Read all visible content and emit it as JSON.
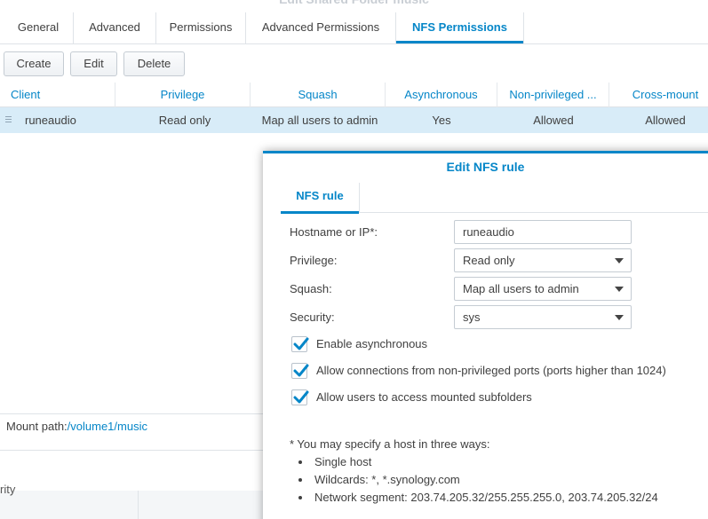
{
  "window": {
    "title": "Edit Shared Folder music"
  },
  "tabs": [
    "General",
    "Advanced",
    "Permissions",
    "Advanced Permissions",
    "NFS Permissions"
  ],
  "toolbar": {
    "create": "Create",
    "edit": "Edit",
    "delete": "Delete"
  },
  "grid": {
    "columns": [
      "Client",
      "Privilege",
      "Squash",
      "Asynchronous",
      "Non-privileged ...",
      "Cross-mount"
    ],
    "rows": [
      {
        "client": "runeaudio",
        "privilege": "Read only",
        "squash": "Map all users to admin",
        "asynchronous": "Yes",
        "non_privileged": "Allowed",
        "cross_mount": "Allowed"
      }
    ]
  },
  "mount": {
    "label": "Mount path:",
    "path": "/volume1/music"
  },
  "background_peek": "rity",
  "modal": {
    "title": "Edit NFS rule",
    "tab": "NFS rule",
    "fields": {
      "hostname": {
        "label": "Hostname or IP*:",
        "value": "runeaudio"
      },
      "privilege": {
        "label": "Privilege:",
        "value": "Read only"
      },
      "squash": {
        "label": "Squash:",
        "value": "Map all users to admin"
      },
      "security": {
        "label": "Security:",
        "value": "sys"
      }
    },
    "checkboxes": [
      {
        "label": "Enable asynchronous",
        "checked": true
      },
      {
        "label": "Allow connections from non-privileged ports (ports higher than 1024)",
        "checked": true
      },
      {
        "label": "Allow users to access mounted subfolders",
        "checked": true
      }
    ],
    "note": "* You may specify a host in three ways:",
    "host_options": [
      "Single host",
      "Wildcards: *, *.synology.com",
      "Network segment: 203.74.205.32/255.255.255.0, 203.74.205.32/24"
    ]
  },
  "colors": {
    "accent": "#0586c8",
    "selected_row": "#d8ecf8",
    "check": "#0586c8"
  }
}
